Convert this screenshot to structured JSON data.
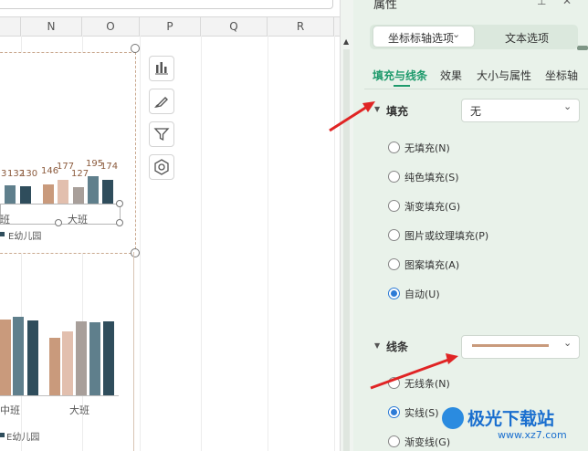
{
  "spreadsheet": {
    "columns": [
      "N",
      "O",
      "P",
      "Q",
      "R"
    ]
  },
  "chart1": {
    "group_labels": [
      "班",
      "大班"
    ],
    "legend": "E幼儿园",
    "data_labels": [
      "3",
      "132",
      "130",
      "146",
      "177",
      "127",
      "195",
      "174"
    ]
  },
  "chart2": {
    "group_labels": [
      "中班",
      "大班"
    ],
    "legend": "E幼儿园"
  },
  "panel": {
    "title": "属性",
    "tabs": {
      "axis_options": "坐标标轴选项",
      "text_options": "文本选项"
    },
    "subtabs": [
      "填充与线条",
      "效果",
      "大小与属性",
      "坐标轴"
    ],
    "fill": {
      "heading": "填充",
      "dropdown_value": "无",
      "options": [
        "无填充(N)",
        "纯色填充(S)",
        "渐变填充(G)",
        "图片或纹理填充(P)",
        "图案填充(A)",
        "自动(U)"
      ],
      "selected_index": 5
    },
    "line": {
      "heading": "线条",
      "color": "#c99a7c",
      "options": [
        "无线条(N)",
        "实线(S)",
        "渐变线(G)"
      ],
      "selected_index": 1
    }
  },
  "watermark": {
    "site": "极光下载站",
    "url": "www.xz7.com"
  },
  "colors": {
    "bar_brown": "#c99a7c",
    "bar_tan": "#e2bfae",
    "bar_grey": "#a89f9a",
    "bar_slate": "#5f7f8c",
    "bar_dark": "#2f4d5c",
    "accent_green": "#1f9a6c",
    "arrow_red": "#e02424"
  }
}
